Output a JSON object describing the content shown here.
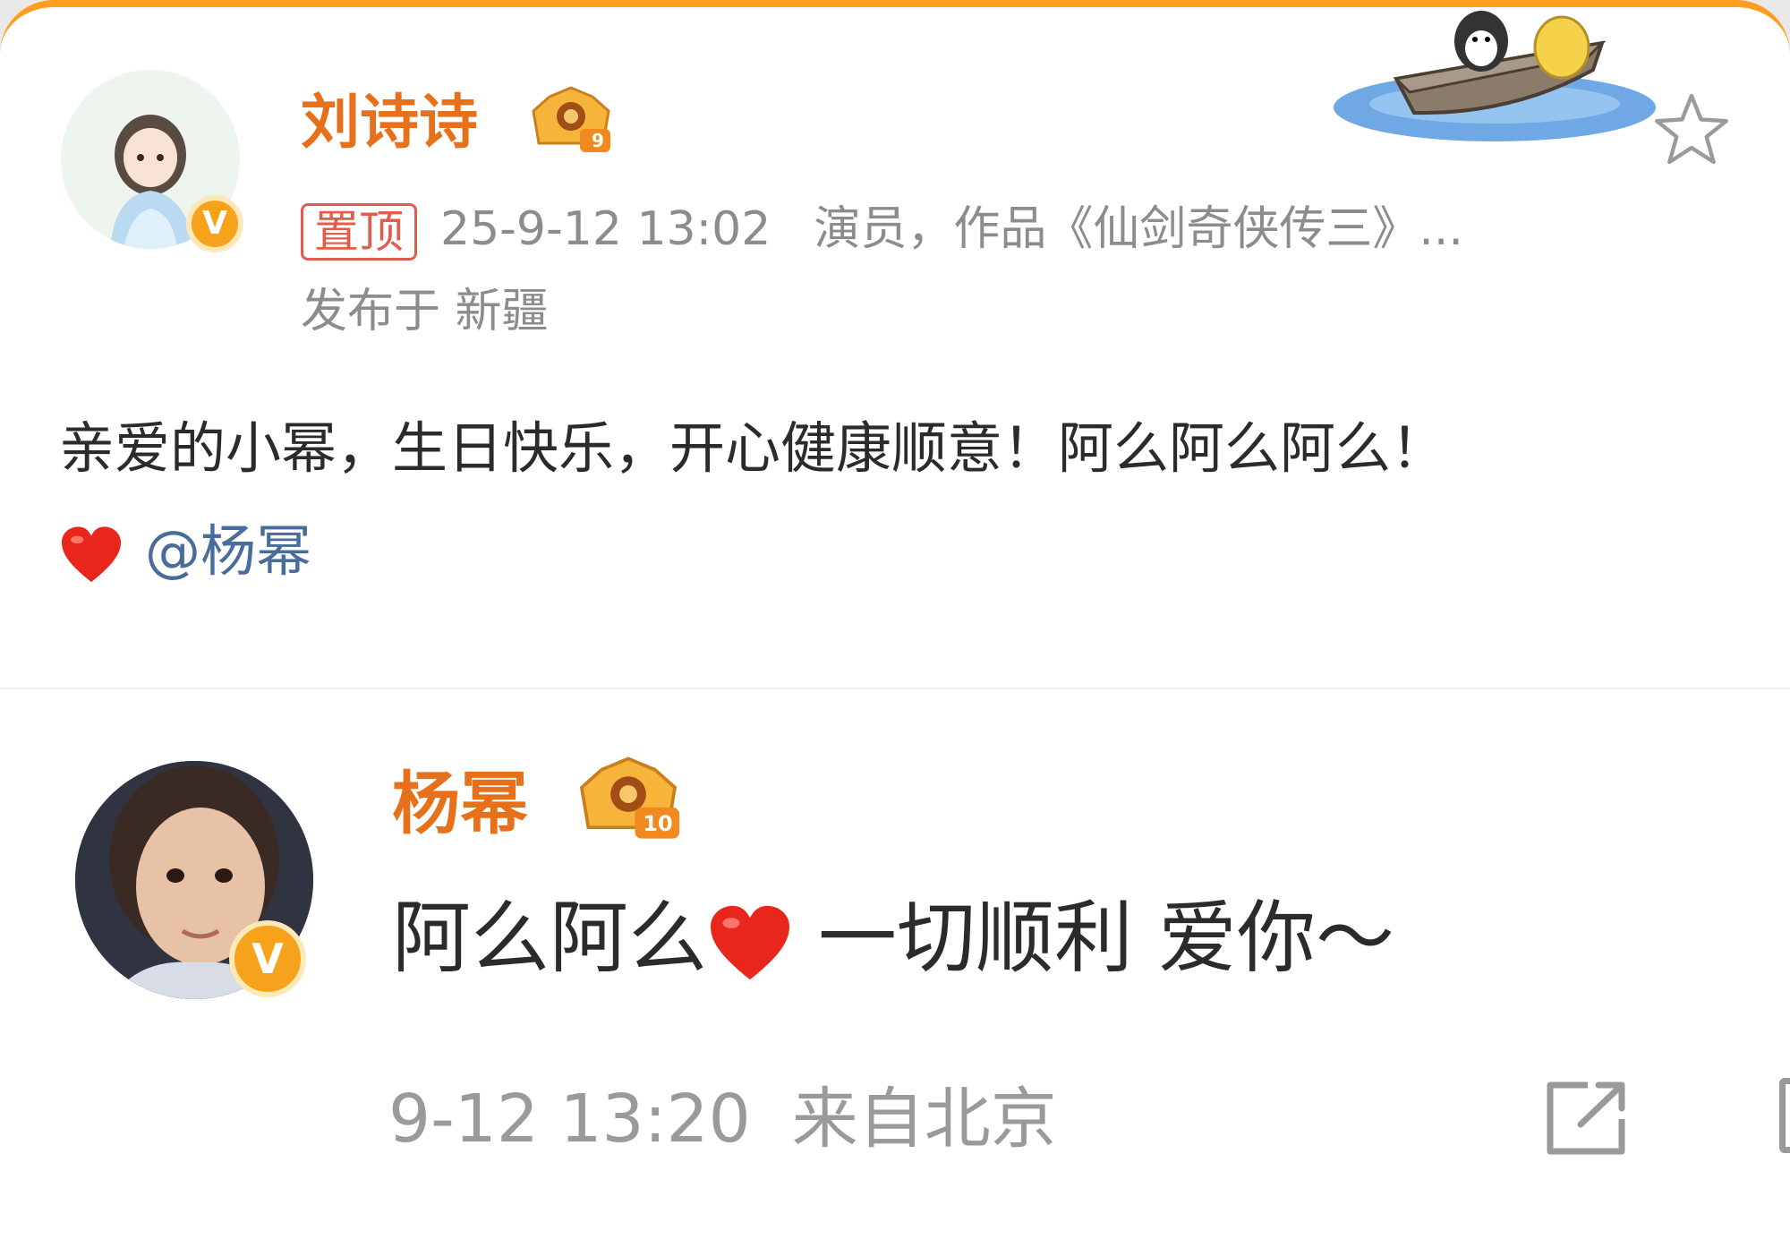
{
  "post": {
    "author": {
      "name": "刘诗诗",
      "level": "9",
      "verified_mark": "V"
    },
    "pin_label": "置顶",
    "timestamp": "25-9-12 13:02",
    "bio": "演员，作品《仙剑奇侠传三》...",
    "location": "发布于 新疆",
    "text": "亲爱的小幂，生日快乐，开心健康顺意！阿么阿么阿么！",
    "mention": "@杨幂",
    "icons": [
      "heart-emoji",
      "star-icon",
      "boat-sticker"
    ]
  },
  "reply": {
    "author": {
      "name": "杨幂",
      "level": "10",
      "verified_mark": "V"
    },
    "text_before": "阿么阿么",
    "text_after": " 一切顺利 爱你～",
    "timestamp": "9-12 13:20",
    "source": "来自北京",
    "icons": [
      "heart-emoji",
      "share-icon"
    ]
  },
  "colors": {
    "name": "#e8701a",
    "meta": "#8c8c8c",
    "mention": "#486c9c",
    "pin": "#e25c4e",
    "top_border": "#ff9d1c"
  }
}
